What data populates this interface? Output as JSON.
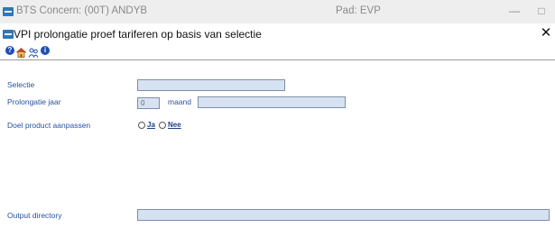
{
  "window": {
    "title": "BTS Concern: (00T) ANDYB",
    "pad": "Pad: EVP",
    "minimize_glyph": "—",
    "maximize_glyph": "□"
  },
  "dialog": {
    "title": "VPI prolongatie proef tariferen op basis van selectie",
    "close_glyph": "✕"
  },
  "toolbar": {
    "help_glyph": "?",
    "info_glyph": "i"
  },
  "form": {
    "selectie": {
      "label": "Selectie",
      "value": ""
    },
    "prolongatie_jaar": {
      "label": "Prolongatie jaar",
      "value": "0"
    },
    "maand": {
      "label": "maand",
      "value": ""
    },
    "doel_product": {
      "label": "Doel product aanpassen",
      "options": [
        "Ja",
        "Nee"
      ]
    },
    "output_directory": {
      "label": "Output directory",
      "value": ""
    }
  },
  "colors": {
    "accent": "#2f77b8",
    "label": "#2552a0",
    "field_bg": "#d6e2f1"
  }
}
